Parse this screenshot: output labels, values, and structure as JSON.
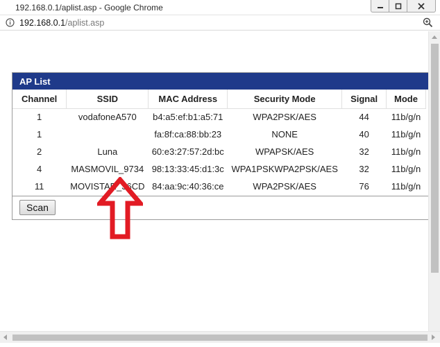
{
  "window": {
    "title": "192.168.0.1/aplist.asp - Google Chrome",
    "url_host": "192.168.0.1",
    "url_path": "/aplist.asp"
  },
  "panel": {
    "title": "AP List",
    "columns": [
      "Channel",
      "SSID",
      "MAC Address",
      "Security Mode",
      "Signal",
      "Mode"
    ],
    "rows": [
      [
        "1",
        "vodafoneA570",
        "b4:a5:ef:b1:a5:71",
        "WPA2PSK/AES",
        "44",
        "11b/g/n"
      ],
      [
        "1",
        "",
        "fa:8f:ca:88:bb:23",
        "NONE",
        "40",
        "11b/g/n"
      ],
      [
        "2",
        "Luna",
        "60:e3:27:57:2d:bc",
        "WPAPSK/AES",
        "32",
        "11b/g/n"
      ],
      [
        "4",
        "MASMOVIL_9734",
        "98:13:33:45:d1:3c",
        "WPA1PSKWPA2PSK/AES",
        "32",
        "11b/g/n"
      ],
      [
        "11",
        "MOVISTAR_36CD",
        "84:aa:9c:40:36:ce",
        "WPA2PSK/AES",
        "76",
        "11b/g/n"
      ]
    ],
    "scan_label": "Scan"
  },
  "colors": {
    "header_blue": "#1f3a8a",
    "annotation_red": "#e21b24"
  },
  "icons": {
    "info": "info-icon",
    "zoom": "zoom-icon",
    "minimize": "minimize-icon",
    "maximize": "maximize-icon",
    "close": "close-icon",
    "annotation": "up-arrow-icon"
  }
}
